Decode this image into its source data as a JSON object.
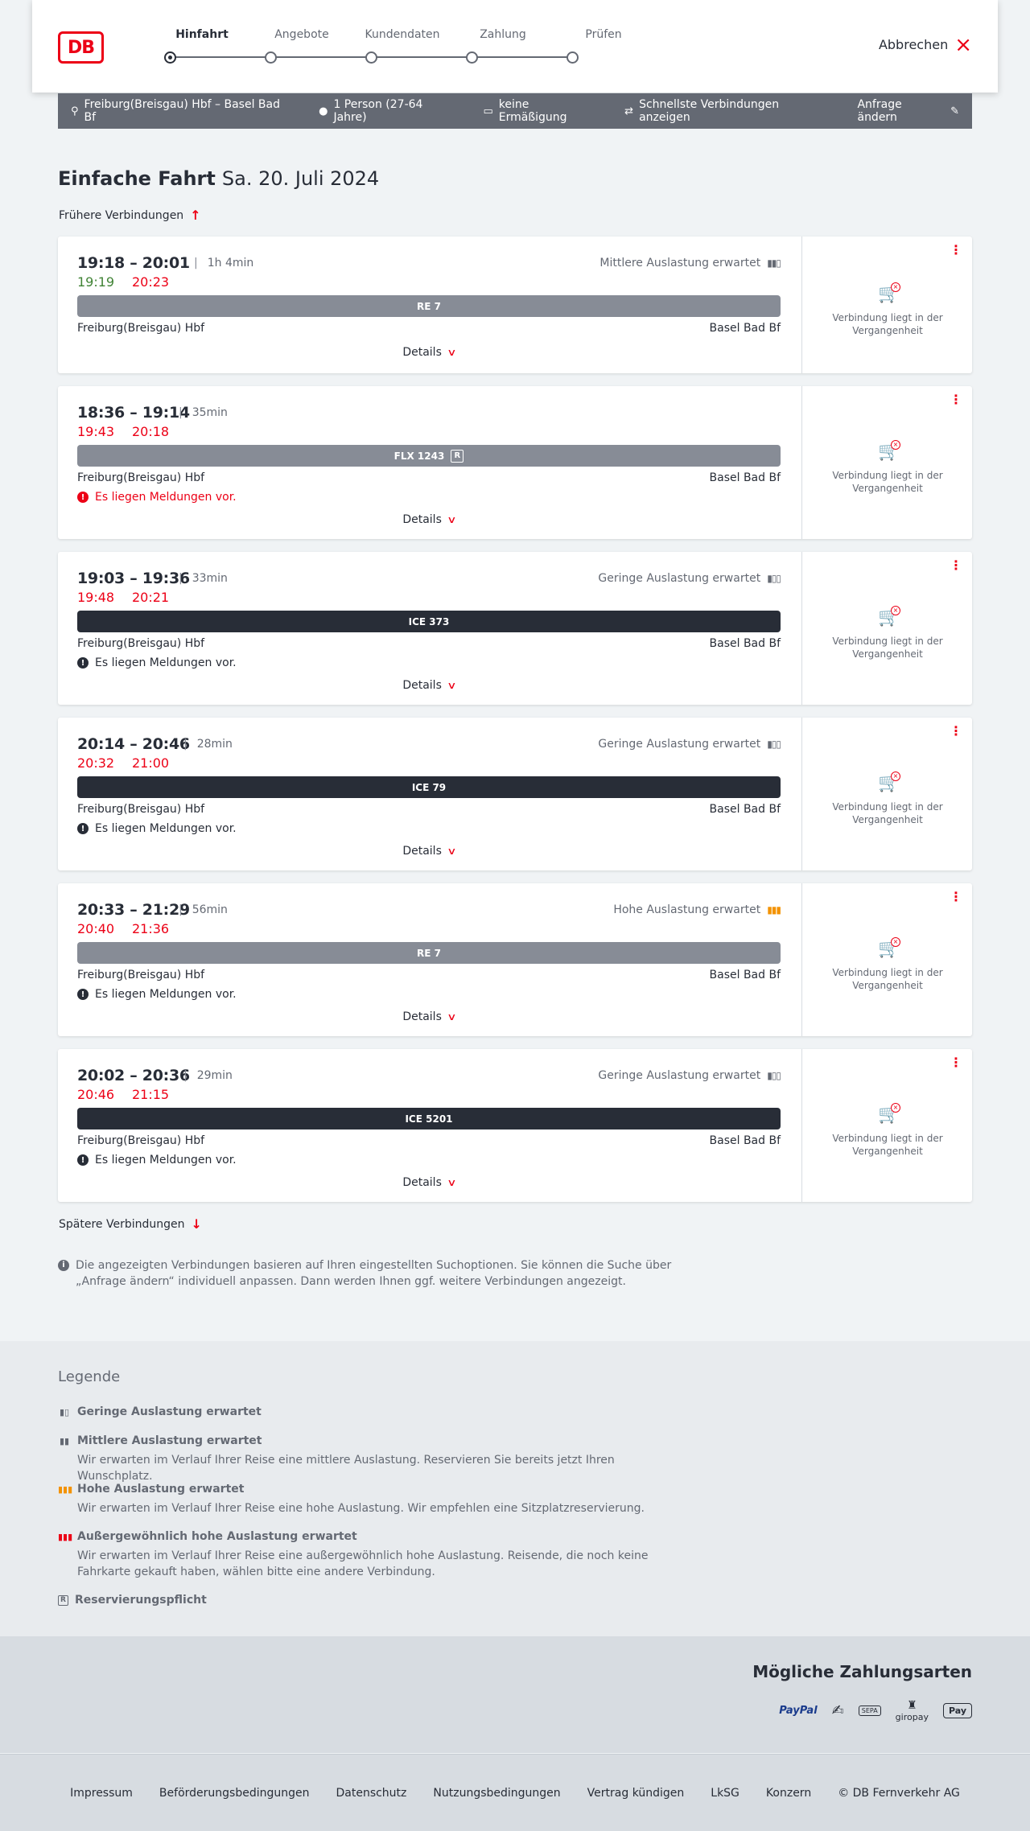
{
  "header": {
    "steps": [
      "Hinfahrt",
      "Angebote",
      "Kundendaten",
      "Zahlung",
      "Prüfen"
    ],
    "active_step": "Hinfahrt",
    "cancel_label": "Abbrechen",
    "logo": "DB"
  },
  "searchbar": {
    "route": "Freiburg(Breisgau) Hbf – Basel Bad Bf",
    "travellers": "1 Person (27-64 Jahre)",
    "discount": "keine Ermäßigung",
    "fastest": "Schnellste Verbindungen anzeigen",
    "change": "Anfrage ändern"
  },
  "title": {
    "main": "Einfache Fahrt",
    "date": "Sa. 20. Juli 2024"
  },
  "earlier_label": "Frühere Verbindungen",
  "later_label": "Spätere Verbindungen",
  "details_label": "Details",
  "past_label": "Verbindung liegt in der Vergangenheit",
  "connections": [
    {
      "times": "19:18 – 20:01",
      "duration": "1h 4min",
      "rt_dep": "19:19",
      "rt_arr": "20:23",
      "rt_dep_color": "#408335",
      "rt_arr_color": "#ec0016",
      "load": "Mittlere Auslastung erwartet",
      "load_icon": "▮▮▯",
      "train": "RE 7",
      "train_style": "grey",
      "reservation": false,
      "from": "Freiburg(Breisgau) Hbf",
      "to": "Basel Bad Bf",
      "message": ""
    },
    {
      "times": "18:36 – 19:14",
      "duration": "35min",
      "rt_dep": "19:43",
      "rt_arr": "20:18",
      "rt_dep_color": "#ec0016",
      "rt_arr_color": "#ec0016",
      "load": "",
      "load_icon": "",
      "train": "FLX 1243",
      "train_style": "grey",
      "reservation": true,
      "from": "Freiburg(Breisgau) Hbf",
      "to": "Basel Bad Bf",
      "message": "Es liegen Meldungen vor.",
      "message_style": "red"
    },
    {
      "times": "19:03 – 19:36",
      "duration": "33min",
      "rt_dep": "19:48",
      "rt_arr": "20:21",
      "rt_dep_color": "#ec0016",
      "rt_arr_color": "#ec0016",
      "load": "Geringe Auslastung erwartet",
      "load_icon": "▮▯▯",
      "train": "ICE 373",
      "train_style": "dark",
      "reservation": false,
      "from": "Freiburg(Breisgau) Hbf",
      "to": "Basel Bad Bf",
      "message": "Es liegen Meldungen vor.",
      "message_style": "dark"
    },
    {
      "times": "20:14 – 20:46",
      "duration": "28min",
      "rt_dep": "20:32",
      "rt_arr": "21:00",
      "rt_dep_color": "#ec0016",
      "rt_arr_color": "#ec0016",
      "load": "Geringe Auslastung erwartet",
      "load_icon": "▮▯▯",
      "train": "ICE 79",
      "train_style": "dark",
      "reservation": false,
      "from": "Freiburg(Breisgau) Hbf",
      "to": "Basel Bad Bf",
      "message": "Es liegen Meldungen vor.",
      "message_style": "dark"
    },
    {
      "times": "20:33 – 21:29",
      "duration": "56min",
      "rt_dep": "20:40",
      "rt_arr": "21:36",
      "rt_dep_color": "#ec0016",
      "rt_arr_color": "#ec0016",
      "load": "Hohe Auslastung erwartet",
      "load_icon": "▮▮▮",
      "load_icon_orange": true,
      "train": "RE 7",
      "train_style": "grey",
      "reservation": false,
      "from": "Freiburg(Breisgau) Hbf",
      "to": "Basel Bad Bf",
      "message": "Es liegen Meldungen vor.",
      "message_style": "dark"
    },
    {
      "times": "20:02 – 20:36",
      "duration": "29min",
      "rt_dep": "20:46",
      "rt_arr": "21:15",
      "rt_dep_color": "#ec0016",
      "rt_arr_color": "#ec0016",
      "load": "Geringe Auslastung erwartet",
      "load_icon": "▮▯▯",
      "train": "ICE 5201",
      "train_style": "dark",
      "reservation": false,
      "from": "Freiburg(Breisgau) Hbf",
      "to": "Basel Bad Bf",
      "message": "Es liegen Meldungen vor.",
      "message_style": "dark"
    }
  ],
  "note": "Die angezeigten Verbindungen basieren auf Ihren eingestellten Suchoptionen. Sie können die Suche über „Anfrage ändern“ individuell anpassen. Dann werden Ihnen ggf. weitere Verbindungen angezeigt.",
  "legend": {
    "heading": "Legende",
    "items": [
      {
        "title": "Geringe Auslastung erwartet",
        "desc": "",
        "icon": "low-load-icon"
      },
      {
        "title": "Mittlere Auslastung erwartet",
        "desc": "Wir erwarten im Verlauf Ihrer Reise eine mittlere Auslastung. Reservieren Sie bereits jetzt Ihren Wunschplatz.",
        "icon": "medium-load-icon"
      },
      {
        "title": "Hohe Auslastung erwartet",
        "desc": "Wir erwarten im Verlauf Ihrer Reise eine hohe Auslastung. Wir empfehlen eine Sitzplatzreservierung.",
        "icon": "high-load-icon"
      },
      {
        "title": "Außergewöhnlich hohe Auslastung erwartet",
        "desc": "Wir erwarten im Verlauf Ihrer Reise eine außergewöhnlich hohe Auslastung. Reisende, die noch keine Fahrkarte gekauft haben, wählen bitte eine andere Verbindung.",
        "icon": "very-high-load-icon"
      },
      {
        "title": "Reservierungspflicht",
        "desc": "",
        "icon": "reservation-icon"
      }
    ]
  },
  "payments": {
    "heading": "Mögliche Zahlungsarten",
    "methods": [
      "PayPal",
      "Lastschrift",
      "SEPA",
      "giropay",
      "Apple Pay"
    ],
    "giropay_label": "giropay",
    "paypal_label": "PayPal",
    "sepa_label": "SEPA",
    "apple_label": "Pay"
  },
  "footer": {
    "links": [
      "Impressum",
      "Beförderungsbedingungen",
      "Datenschutz",
      "Nutzungsbedingungen",
      "Vertrag kündigen",
      "LkSG",
      "Konzern",
      "© DB Fernverkehr AG"
    ]
  }
}
